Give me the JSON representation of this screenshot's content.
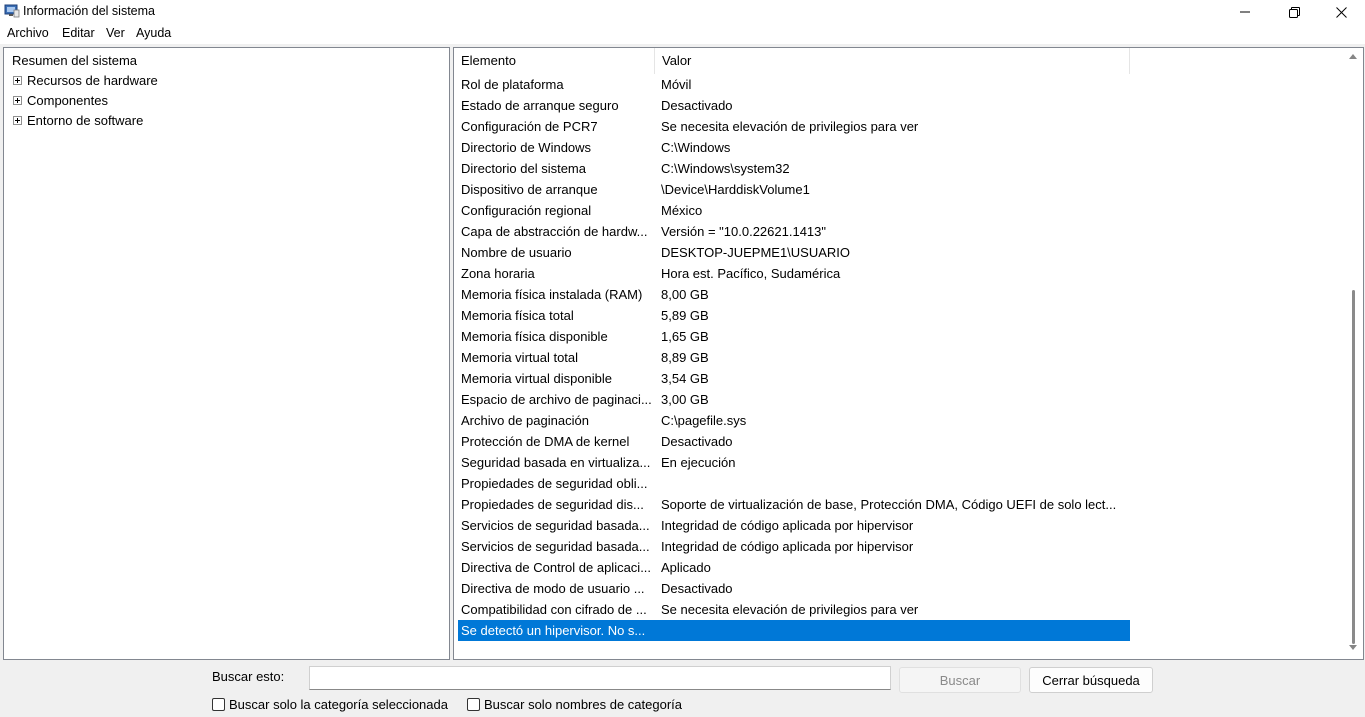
{
  "window": {
    "title": "Información del sistema"
  },
  "menu": [
    "Archivo",
    "Editar",
    "Ver",
    "Ayuda"
  ],
  "tree": {
    "root": "Resumen del sistema",
    "children": [
      "Recursos de hardware",
      "Componentes",
      "Entorno de software"
    ]
  },
  "list": {
    "headers": {
      "element": "Elemento",
      "value": "Valor"
    },
    "rows": [
      {
        "element": "Rol de plataforma",
        "value": "Móvil"
      },
      {
        "element": "Estado de arranque seguro",
        "value": "Desactivado"
      },
      {
        "element": "Configuración de PCR7",
        "value": "Se necesita elevación de privilegios para ver"
      },
      {
        "element": "Directorio de Windows",
        "value": "C:\\Windows"
      },
      {
        "element": "Directorio del sistema",
        "value": "C:\\Windows\\system32"
      },
      {
        "element": "Dispositivo de arranque",
        "value": "\\Device\\HarddiskVolume1"
      },
      {
        "element": "Configuración regional",
        "value": "México"
      },
      {
        "element": "Capa de abstracción de hardw...",
        "value": "Versión = \"10.0.22621.1413\""
      },
      {
        "element": "Nombre de usuario",
        "value": "DESKTOP-JUEPME1\\USUARIO"
      },
      {
        "element": "Zona horaria",
        "value": "Hora est. Pacífico, Sudamérica"
      },
      {
        "element": "Memoria física instalada (RAM)",
        "value": "8,00 GB"
      },
      {
        "element": "Memoria física total",
        "value": "5,89 GB"
      },
      {
        "element": "Memoria física disponible",
        "value": "1,65 GB"
      },
      {
        "element": "Memoria virtual total",
        "value": "8,89 GB"
      },
      {
        "element": "Memoria virtual disponible",
        "value": "3,54 GB"
      },
      {
        "element": "Espacio de archivo de paginaci...",
        "value": "3,00 GB"
      },
      {
        "element": "Archivo de paginación",
        "value": "C:\\pagefile.sys"
      },
      {
        "element": "Protección de DMA de kernel",
        "value": "Desactivado"
      },
      {
        "element": "Seguridad basada en virtualiza...",
        "value": "En ejecución"
      },
      {
        "element": "Propiedades de seguridad obli...",
        "value": ""
      },
      {
        "element": "Propiedades de seguridad dis...",
        "value": "Soporte de virtualización de base, Protección DMA, Código UEFI de solo lect..."
      },
      {
        "element": "Servicios de seguridad basada...",
        "value": "Integridad de código aplicada por hipervisor"
      },
      {
        "element": "Servicios de seguridad basada...",
        "value": "Integridad de código aplicada por hipervisor"
      },
      {
        "element": "Directiva de Control de aplicaci...",
        "value": "Aplicado"
      },
      {
        "element": "Directiva de modo de usuario ...",
        "value": "Desactivado"
      },
      {
        "element": "Compatibilidad con cifrado de ...",
        "value": "Se necesita elevación de privilegios para ver"
      },
      {
        "element": "Se detectó un hipervisor. No s...",
        "value": "",
        "selected": true
      }
    ]
  },
  "search": {
    "label": "Buscar esto:",
    "value": "",
    "search_button": "Buscar",
    "close_button": "Cerrar búsqueda",
    "only_selected_category": "Buscar solo la categoría seleccionada",
    "only_category_names": "Buscar solo nombres de categoría"
  },
  "colors": {
    "selection": "#0078d7",
    "border": "#828790"
  }
}
